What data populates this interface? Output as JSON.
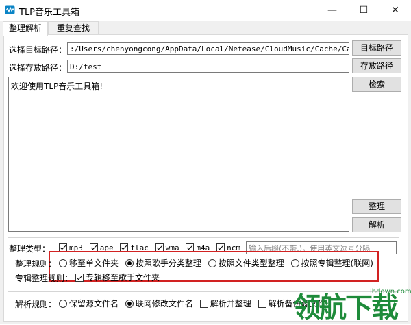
{
  "window": {
    "title": "TLP音乐工具箱",
    "minimize_glyph": "—",
    "maximize_glyph": "☐",
    "close_glyph": "✕"
  },
  "tabs": [
    {
      "label": "整理解析",
      "active": true
    },
    {
      "label": "重复查找",
      "active": false
    }
  ],
  "source_path": {
    "label": "选择目标路径：",
    "value": ":/Users/chenyongcong/AppData/Local/Netease/CloudMusic/Cache/Cache",
    "button": "目标路径"
  },
  "dest_path": {
    "label": "选择存放路径：",
    "value": "D:/test",
    "button": "存放路径"
  },
  "buttons": {
    "search": "检索",
    "organize": "整理",
    "parse": "解析"
  },
  "log": {
    "text": "欢迎使用TLP音乐工具箱!"
  },
  "types": {
    "label": "整理类型：",
    "items": [
      {
        "label": "mp3",
        "checked": true
      },
      {
        "label": "ape",
        "checked": true
      },
      {
        "label": "flac",
        "checked": true
      },
      {
        "label": "wma",
        "checked": true
      },
      {
        "label": "m4a",
        "checked": true
      },
      {
        "label": "ncm",
        "checked": true
      }
    ],
    "suffix_placeholder": "输入后缀(不带.)，使用英文逗号分隔"
  },
  "rules": {
    "label": "整理规则：",
    "options": [
      {
        "label": "移至单文件夹",
        "selected": false
      },
      {
        "label": "按照歌手分类整理",
        "selected": true
      },
      {
        "label": "按照文件类型整理",
        "selected": false
      },
      {
        "label": "按照专辑整理(联网)",
        "selected": false
      }
    ]
  },
  "album_rules": {
    "label": "专辑整理规则：",
    "option": {
      "label": "专辑移至歌手文件夹",
      "checked": true
    }
  },
  "parse_rules": {
    "label": "解析规则：",
    "options": [
      {
        "label": "保留源文件名",
        "selected": false,
        "kind": "radio"
      },
      {
        "label": "联网修改文件名",
        "selected": true,
        "kind": "radio"
      },
      {
        "label": "解析并整理",
        "checked": false,
        "kind": "checkbox"
      },
      {
        "label": "解析备份源文件",
        "checked": false,
        "kind": "checkbox"
      }
    ]
  },
  "watermark": {
    "text": "领航下载",
    "url": "lhdown.com"
  },
  "colors": {
    "highlight": "#d22222",
    "watermark": "#1e8b3a"
  }
}
